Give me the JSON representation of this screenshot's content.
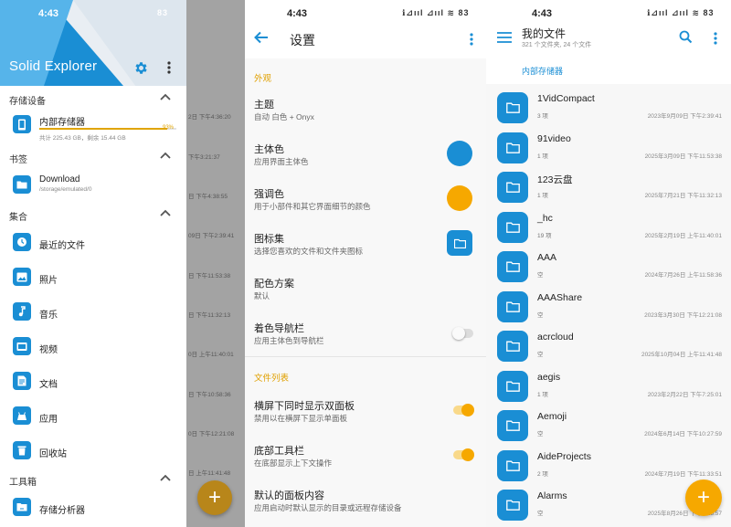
{
  "colors": {
    "accent_blue": "#1a8ed4",
    "accent_orange": "#f6a800",
    "primary_circle": "#1a8ed4",
    "accent_circle": "#f6a800"
  },
  "status": {
    "time": "4:43",
    "icons": "ℹ︎⊿ııl ⊿ııl ≋ 83"
  },
  "s1": {
    "app_title": "Solid Explorer",
    "bg_timestamps": [
      "2日 下午4:36:20",
      "下午3:21:37",
      "日 下午4:38:55",
      "09日 下午2:39:41",
      "日 下午11:53:38",
      "日 下午11:32:13",
      "0日 上午11:40:01",
      "日 下午10:58:36",
      "0日 下午12:21:08",
      "日 上午11:41:48"
    ],
    "sections": {
      "storage": "存储设备",
      "bookmarks": "书签",
      "collections": "集合",
      "toolbox": "工具箱"
    },
    "storage_item": {
      "label": "内部存储器",
      "sub": "共计 225.43 GB，剩余 15.44 GB",
      "percent": "93%",
      "used_fraction": 0.93
    },
    "bookmark_item": {
      "label": "Download",
      "sub": "/storage/emulated/0"
    },
    "collections": [
      {
        "label": "最近的文件",
        "icon": "clock-icon"
      },
      {
        "label": "照片",
        "icon": "image-icon"
      },
      {
        "label": "音乐",
        "icon": "music-icon"
      },
      {
        "label": "视频",
        "icon": "video-icon"
      },
      {
        "label": "文档",
        "icon": "document-icon"
      },
      {
        "label": "应用",
        "icon": "app-icon"
      },
      {
        "label": "回收站",
        "icon": "trash-icon"
      }
    ],
    "toolbox_item": {
      "label": "存储分析器",
      "icon": "analyzer-icon"
    }
  },
  "s2": {
    "title": "设置",
    "cat_appearance": "外观",
    "cat_filelist": "文件列表",
    "rows": [
      {
        "title": "主题",
        "sub": "自动 白色 + Onyx"
      },
      {
        "title": "主体色",
        "sub": "应用界面主体色"
      },
      {
        "title": "强调色",
        "sub": "用于小部件和其它界面细节的颜色"
      },
      {
        "title": "图标集",
        "sub": "选择您喜欢的文件和文件夹图标"
      },
      {
        "title": "配色方案",
        "sub": "默认"
      },
      {
        "title": "着色导航栏",
        "sub": "应用主体色到导航栏"
      },
      {
        "title": "横屏下同时显示双面板",
        "sub": "禁用以在横屏下显示单面板"
      },
      {
        "title": "底部工具栏",
        "sub": "在底部显示上下文操作"
      },
      {
        "title": "默认的面板内容",
        "sub": "应用启动时默认显示的目录或远程存储设备"
      }
    ],
    "toggles": {
      "tinted_nav": false,
      "dual_panel": true,
      "bottom_toolbar": true
    }
  },
  "s3": {
    "title": "我的文件",
    "subtitle": "321 个文件夹, 24 个文件",
    "breadcrumb": "内部存储器",
    "files": [
      {
        "name": "1VidCompact",
        "count": "3 项",
        "date": "2023年9月09日 下午2:39:41"
      },
      {
        "name": "91video",
        "count": "1 项",
        "date": "2025年3月09日 下午11:53:38"
      },
      {
        "name": "123云盘",
        "count": "1 项",
        "date": "2025年7月21日 下午11:32:13"
      },
      {
        "name": "_hc",
        "count": "19 项",
        "date": "2025年2月19日 上午11:40:01"
      },
      {
        "name": "AAA",
        "count": "空",
        "date": "2024年7月26日 上午11:58:36"
      },
      {
        "name": "AAAShare",
        "count": "空",
        "date": "2023年3月30日 下午12:21:08"
      },
      {
        "name": "acrcloud",
        "count": "空",
        "date": "2025年10月04日 上午11:41:48"
      },
      {
        "name": "aegis",
        "count": "1 项",
        "date": "2023年2月22日 下午7:25:01"
      },
      {
        "name": "Aemoji",
        "count": "空",
        "date": "2024年6月14日 下午10:27:59"
      },
      {
        "name": "AideProjects",
        "count": "2 项",
        "date": "2024年7月19日 下午11:33:51"
      },
      {
        "name": "Alarms",
        "count": "空",
        "date": "2025年8月26日 下午2:25:57"
      }
    ]
  }
}
